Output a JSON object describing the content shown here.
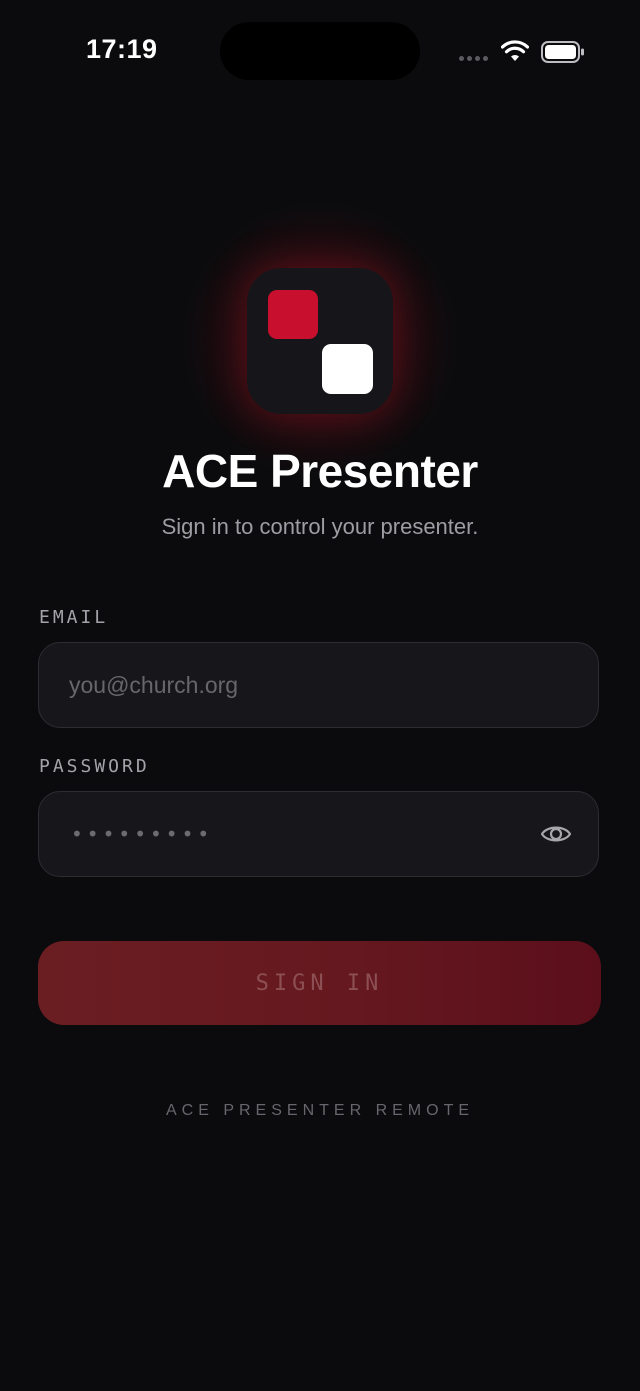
{
  "status_bar": {
    "time": "17:19"
  },
  "app": {
    "title": "ACE Presenter",
    "subtitle": "Sign in to control your presenter.",
    "logo_colors": {
      "background": "#16161a",
      "red_square": "#c8102e",
      "white_square": "#ffffff"
    }
  },
  "form": {
    "email_label": "EMAIL",
    "email_placeholder": "you@church.org",
    "email_value": "",
    "password_label": "PASSWORD",
    "password_masked": "•••••••••",
    "submit_label": "SIGN IN"
  },
  "footer": {
    "text": "ACE PRESENTER REMOTE"
  },
  "colors": {
    "background": "#0b0b0d",
    "accent": "#c8102e",
    "button_gradient_start": "#6b1e22",
    "button_gradient_end": "#5b0f1b"
  },
  "icons": {
    "wifi": "wifi-icon",
    "battery": "battery-icon",
    "show_password": "eye-icon"
  }
}
